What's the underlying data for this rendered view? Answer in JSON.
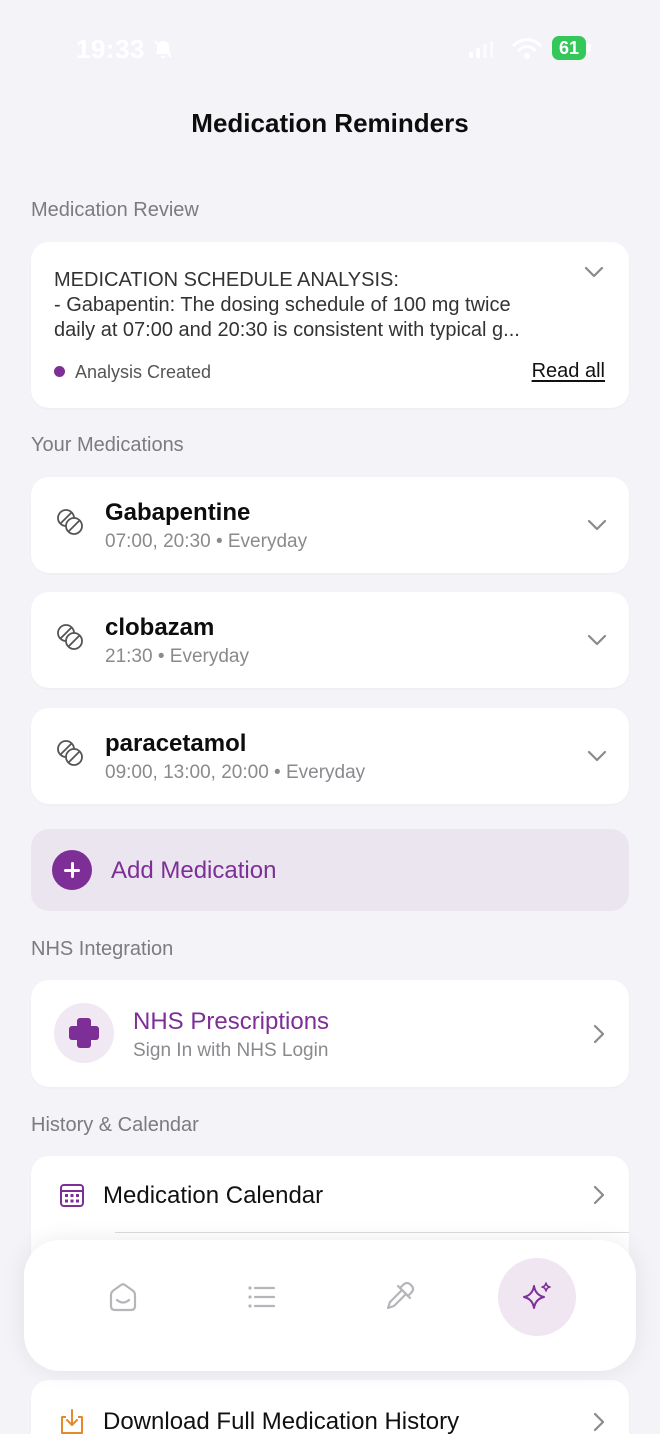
{
  "status_bar": {
    "time": "19:33",
    "battery": "61"
  },
  "header": {
    "title": "Medication Reminders"
  },
  "review": {
    "section_label": "Medication Review",
    "text_line_1": "MEDICATION SCHEDULE ANALYSIS:",
    "text_line_2": "- Gabapentin: The dosing schedule of 100 mg twice",
    "text_line_3": "daily at 07:00 and 20:30 is consistent with typical g...",
    "status": "Analysis Created",
    "read_all": "Read all"
  },
  "medications": {
    "section_label": "Your Medications",
    "items": [
      {
        "name": "Gabapentine",
        "times": "07:00, 20:30",
        "frequency": "Everyday"
      },
      {
        "name": "clobazam",
        "times": "21:30",
        "frequency": "Everyday"
      },
      {
        "name": "paracetamol",
        "times": "09:00, 13:00, 20:00",
        "frequency": "Everyday"
      }
    ],
    "separator": "•",
    "add_label": "Add Medication"
  },
  "nhs": {
    "section_label": "NHS Integration",
    "title": "NHS Prescriptions",
    "subtitle": "Sign In with NHS Login"
  },
  "history": {
    "section_label": "History & Calendar",
    "calendar_label": "Medication Calendar",
    "download_label": "Download Full Medication History"
  },
  "tab_bar": {
    "tabs": [
      "home-icon",
      "list-icon",
      "dropper-icon",
      "sparkle-icon"
    ],
    "active": "sparkle-icon"
  },
  "colors": {
    "accent": "#7d2f97",
    "accent_light": "#ebe5ef",
    "background": "#f4f3f7",
    "battery": "#34c759"
  }
}
